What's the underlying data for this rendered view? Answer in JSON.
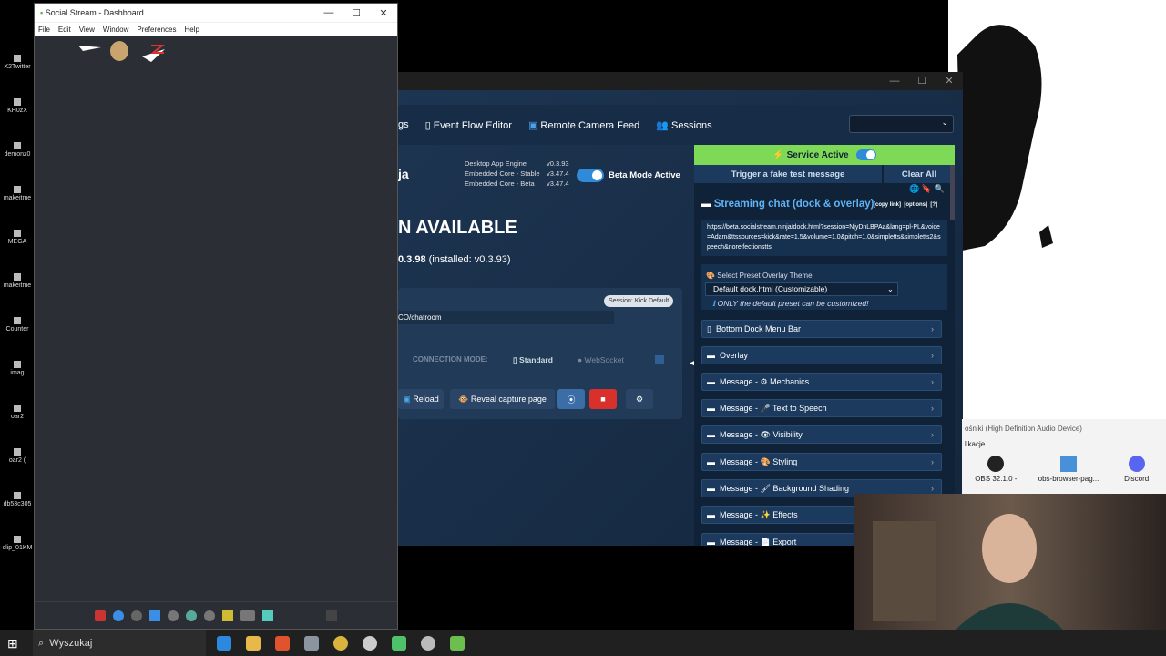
{
  "desktop_icons": [
    "X2Twitter",
    "KH0zX",
    "demonz0",
    "makeitme",
    "MEGA",
    "makeitme",
    "Counter",
    "imag",
    "oar2",
    "oar2 (",
    "db53c305",
    "clip_01KM"
  ],
  "social_stream": {
    "title": "Social Stream - Dashboard",
    "menu": [
      "File",
      "Edit",
      "View",
      "Window",
      "Preferences",
      "Help"
    ],
    "controls": {
      "minimize": "—",
      "maximize": "☐",
      "close": "✕"
    }
  },
  "dashboard": {
    "window_controls": {
      "minimize": "—",
      "maximize": "☐",
      "close": "✕"
    },
    "nav": {
      "partial": "gs",
      "event_flow": "Event Flow Editor",
      "remote_camera": "Remote Camera Feed",
      "sessions": "Sessions"
    },
    "brand_partial": "ja",
    "versions": {
      "desktop_label": "Desktop App Engine",
      "desktop_value": "v0.3.93",
      "stable_label": "Embedded Core - Stable",
      "stable_value": "v3.47.4",
      "beta_label": "Embedded Core - Beta",
      "beta_value": "v3.47.4"
    },
    "beta_mode": "Beta Mode Active",
    "update_heading": "N AVAILABLE",
    "update_version": "0.3.98",
    "update_installed": "(installed: v0.3.93)",
    "session_badge": "Session: Kick Default",
    "channel_value": "CO/chatroom",
    "connection_mode_label": "CONNECTION MODE:",
    "mode_standard": "Standard",
    "mode_websocket": "WebSocket",
    "reload": "Reload",
    "reveal": "Reveal capture page",
    "collapse_arrow": "◀"
  },
  "right_panel": {
    "service_active": "Service Active",
    "trigger": "Trigger a fake test message",
    "clear_all": "Clear All",
    "streaming_title": "Streaming chat (dock & overlay)",
    "copy_link": "[copy link]",
    "options": "[options]",
    "help": "[?]",
    "url": "https://beta.socialstream.ninja/dock.html?session=NjyDnLBPAa&lang=pl-PL&voice=Adam&ttssources=kick&rate=1.5&volume=1.0&pitch=1.0&simpletts&simpletts2&speech&norelfectionstts",
    "preset_label": "Select Preset Overlay Theme:",
    "preset_value": "Default dock.html (Customizable)",
    "preset_note": "ONLY the default preset can be customized!",
    "accordions": [
      "Bottom Dock Menu Bar",
      "Overlay",
      "Message - ⚙ Mechanics",
      "Message - 🎤 Text to Speech",
      "Message - 👁 Visibility",
      "Message - 🎨 Styling",
      "Message - 🖌 Background Shading",
      "Message - ✨ Effects",
      "Message - 📄 Export"
    ]
  },
  "popup": {
    "device": "ośniki (High Definition Audio Device)",
    "section": "likacje",
    "apps": [
      "OBS 32.1.0 -",
      "obs-browser-pag...",
      "Discord"
    ]
  },
  "taskbar": {
    "search_placeholder": "Wyszukaj"
  },
  "colors": {
    "accent_green": "#7ed957",
    "toggle": "#2f8bd8",
    "danger": "#d9302c"
  }
}
